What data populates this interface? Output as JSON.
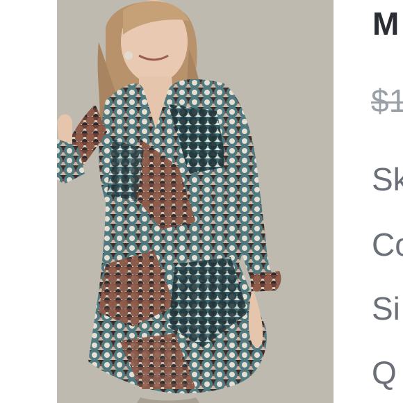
{
  "product": {
    "title": "M",
    "original_price": "$1",
    "attributes": {
      "sku_label": "Sk",
      "color_label": "Co",
      "size_label": "Si",
      "quantity_label": "Q"
    }
  },
  "image": {
    "description": "product-photo",
    "background_color": "#bdb8ae"
  }
}
